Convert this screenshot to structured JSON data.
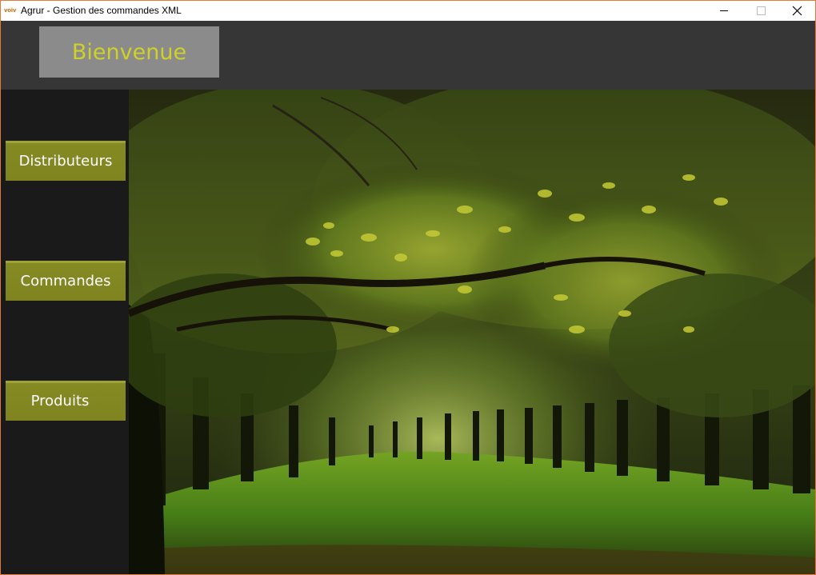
{
  "window": {
    "icon_text": "voiv",
    "title": "Agrur - Gestion des commandes XML",
    "controls": [
      "minimize",
      "maximize",
      "close"
    ]
  },
  "header": {
    "welcome_label": "Bienvenue"
  },
  "sidebar": {
    "items": [
      {
        "label": "Distributeurs"
      },
      {
        "label": "Commandes"
      },
      {
        "label": "Produits"
      }
    ]
  },
  "hero": {
    "image": "orchard-avenue-trees"
  },
  "colors": {
    "accent": "#808520",
    "welcome_text": "#cfd12a",
    "header_bg": "#363636",
    "sidebar_bg": "#1a1a1a",
    "window_border": "#e07a3a"
  }
}
